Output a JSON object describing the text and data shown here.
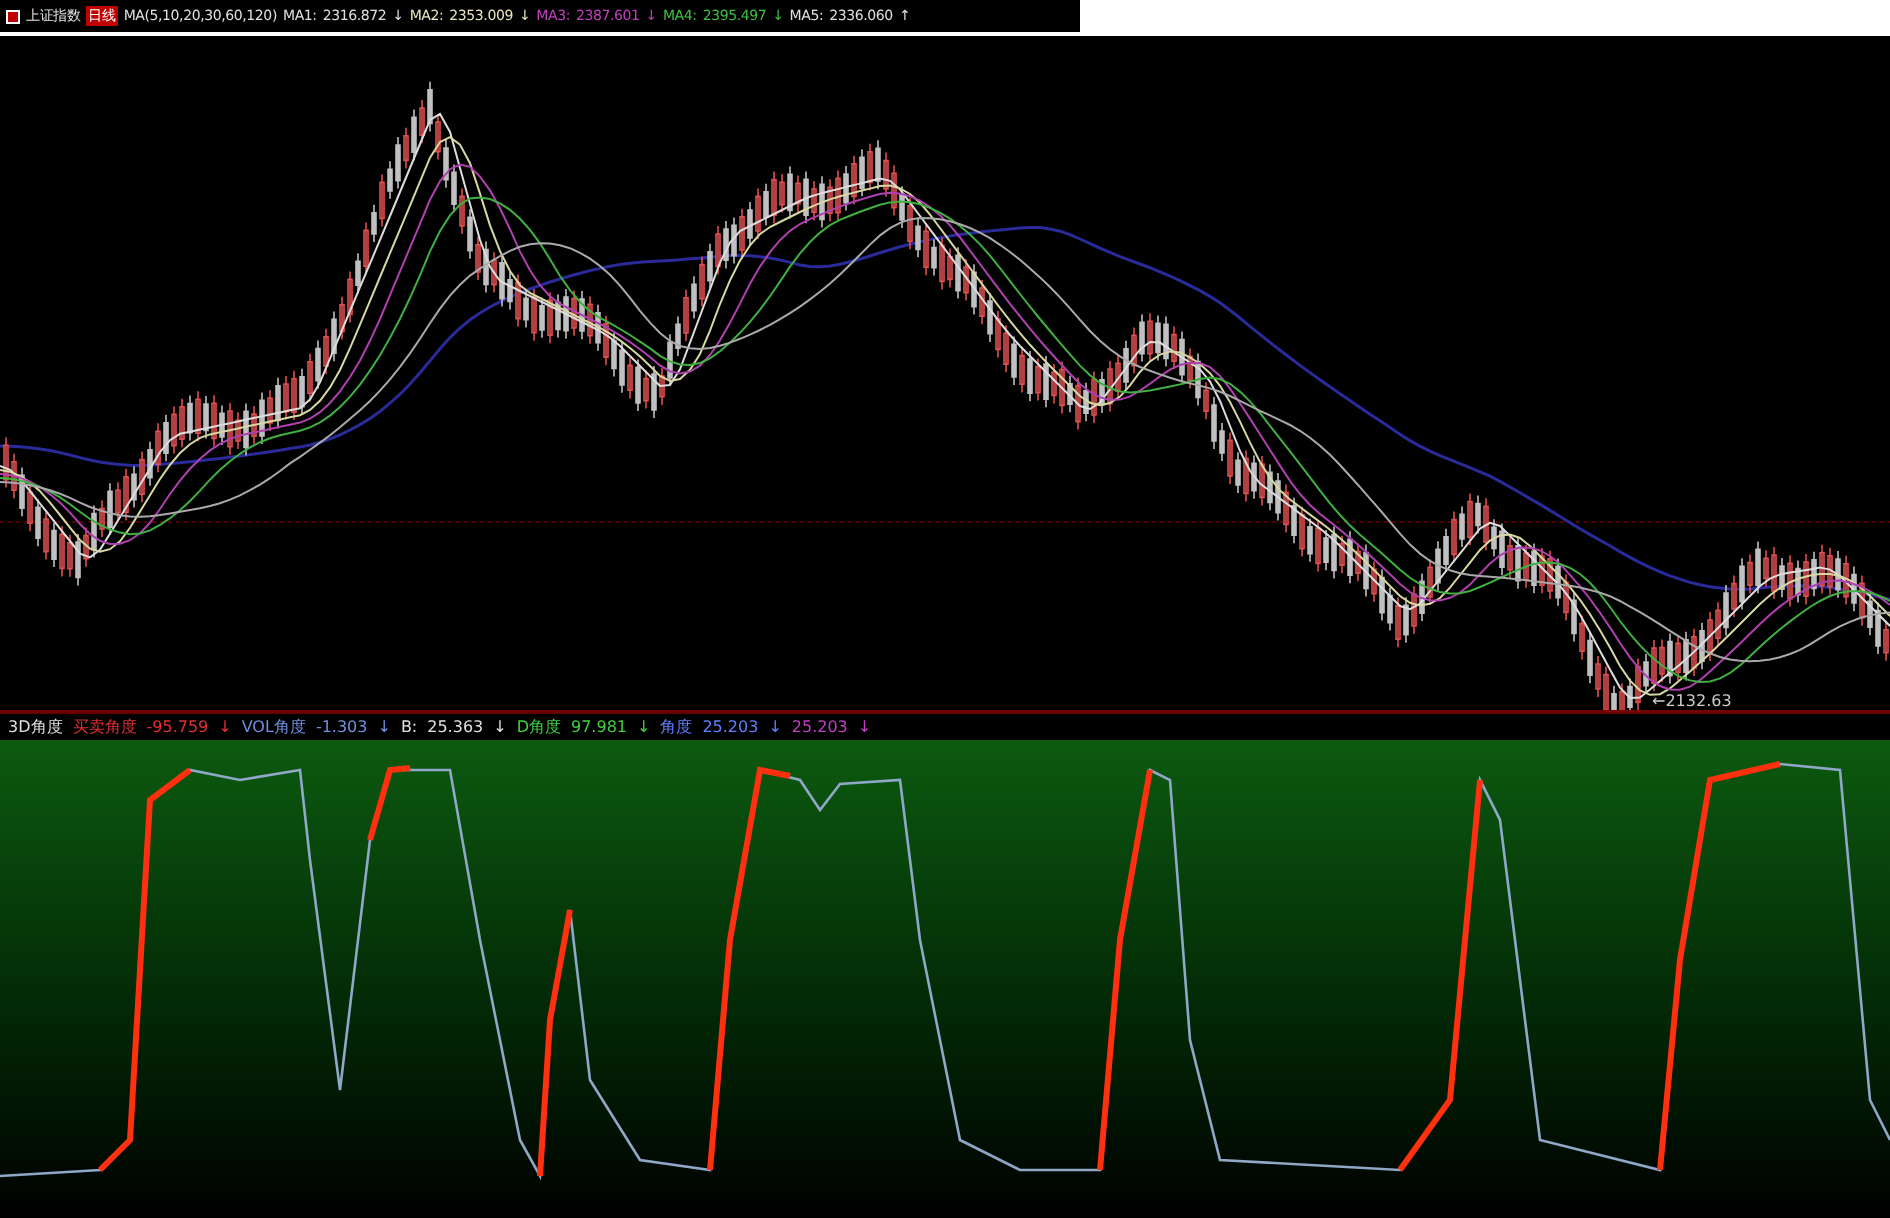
{
  "main_panel": {
    "title": "上证指数",
    "period": "日线",
    "ma_params": "MA(5,10,20,30,60,120)",
    "indicators": [
      {
        "label": "MA1:",
        "value": "2316.872",
        "arrow": "↓",
        "color": "#e0e0e0"
      },
      {
        "label": "MA2:",
        "value": "2353.009",
        "arrow": "↓",
        "color": "#e8e8c0"
      },
      {
        "label": "MA3:",
        "value": "2387.601",
        "arrow": "↓",
        "color": "#c040c0"
      },
      {
        "label": "MA4:",
        "value": "2395.497",
        "arrow": "↓",
        "color": "#40c040"
      },
      {
        "label": "MA5:",
        "value": "2336.060",
        "arrow": "↑",
        "color": "#e0e0e0"
      }
    ],
    "low_label": "←2132.63"
  },
  "sub_panel": {
    "title": "3D角度",
    "indicators": [
      {
        "label": "买卖角度",
        "value": "-95.759",
        "arrow": "↓",
        "color": "#e03030"
      },
      {
        "label": "VOL角度",
        "value": "-1.303",
        "arrow": "↓",
        "color": "#7090e0"
      },
      {
        "label": "B:",
        "value": "25.363",
        "arrow": "↓",
        "color": "#e0e0e0"
      },
      {
        "label": "D角度",
        "value": "97.981",
        "arrow": "↓",
        "color": "#40d040"
      },
      {
        "label": "角度",
        "value": "25.203",
        "arrow": "↓",
        "color": "#6080ff"
      },
      {
        "value": "25.203",
        "arrow": "↓",
        "color": "#c040c0"
      }
    ]
  }
}
